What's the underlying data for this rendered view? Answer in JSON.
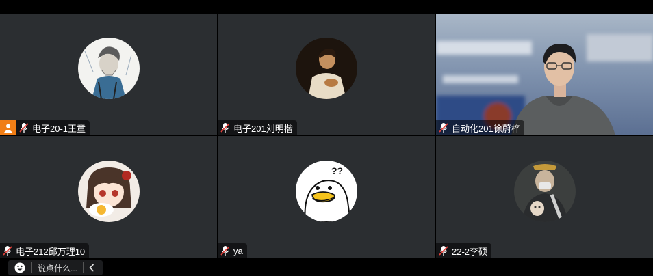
{
  "participants": [
    {
      "name": "电子20-1王童",
      "host": true,
      "muted": true,
      "avatar": "sketch-person-photo"
    },
    {
      "name": "电子201刘明楷",
      "host": false,
      "muted": true,
      "avatar": "painting-boy-photo"
    },
    {
      "name": "自动化201徐蔚梓",
      "host": false,
      "muted": true,
      "avatar": "live-camera-video"
    },
    {
      "name": "电子212邱万理10",
      "host": false,
      "muted": true,
      "avatar": "anime-girl-photo"
    },
    {
      "name": "ya",
      "host": false,
      "muted": true,
      "avatar": "cartoon-duck-photo"
    },
    {
      "name": "22-2李硕",
      "host": false,
      "muted": true,
      "avatar": "person-with-cat-photo"
    }
  ],
  "chat": {
    "placeholder": "说点什么..."
  },
  "colors": {
    "tile_bg": "#2b2e31",
    "host_badge": "#f07e16",
    "mute_red": "#e2403b"
  }
}
